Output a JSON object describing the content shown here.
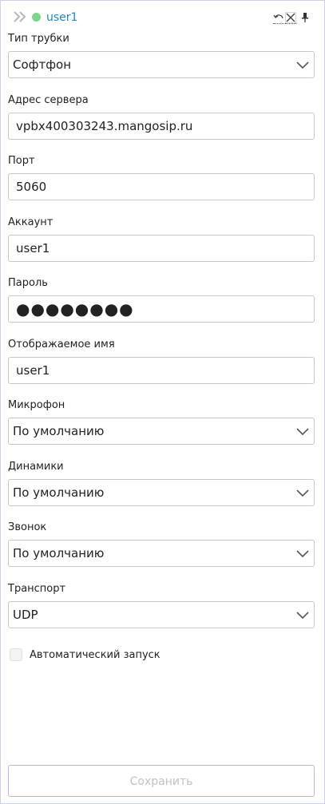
{
  "header": {
    "username": "user1",
    "status_color": "#7ed48a",
    "username_color": "#1f86c8",
    "icons": [
      "double-chevron-right-icon",
      "undo-icon",
      "close-icon",
      "pin-icon"
    ]
  },
  "form": {
    "phone_type": {
      "label": "Тип трубки",
      "value": "Софтфон"
    },
    "server_address": {
      "label": "Адрес сервера",
      "value": "vpbx400303243.mangosip.ru"
    },
    "port": {
      "label": "Порт",
      "value": "5060"
    },
    "account": {
      "label": "Аккаунт",
      "value": "user1"
    },
    "password": {
      "label": "Пароль",
      "value": "●●●●●●●●"
    },
    "display_name": {
      "label": "Отображаемое имя",
      "value": "user1"
    },
    "microphone": {
      "label": "Микрофон",
      "value": "По умолчанию"
    },
    "speakers": {
      "label": "Динамики",
      "value": "По умолчанию"
    },
    "ringer": {
      "label": "Звонок",
      "value": "По умолчанию"
    },
    "transport": {
      "label": "Транспорт",
      "value": "UDP"
    },
    "autostart": {
      "label": "Автоматический запуск",
      "checked": false
    }
  },
  "footer": {
    "save_label": "Сохранить"
  }
}
